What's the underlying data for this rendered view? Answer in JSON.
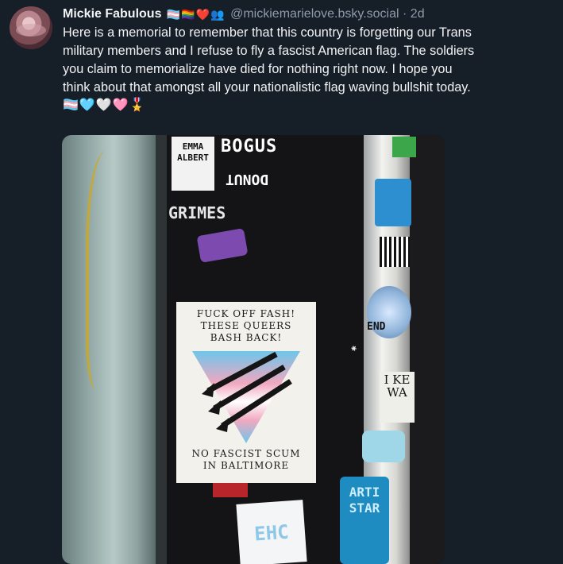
{
  "post": {
    "author_name": "Mickie Fabulous",
    "author_badges": "🏳️‍⚧️🏳️‍🌈❤️👥",
    "handle": "@mickiemarielove.bsky.social",
    "separator": "·",
    "timestamp": "2d",
    "text_lines": [
      "Here is a memorial to remember that this country is forgetting our Trans",
      "military members and I refuse to fly a fascist American flag. The soldiers",
      "you claim to memorialize have died for nothing right now. I hope you",
      "think about that amongst all your nationalistic flag waving bullshit today."
    ],
    "emoji_line": "🏳️‍⚧️🩵🤍🩷🎖️"
  },
  "photo": {
    "stickers": {
      "bogus": "BOGUS",
      "donut": "DONUT",
      "grimes": "GRIMES",
      "emma": "EMMA ALBERT",
      "end": "END",
      "ken": "I KE WA",
      "artistar": "ARTI STAR",
      "ehc": "EHC"
    },
    "poster": {
      "top_lines": [
        "FUCK OFF FASH!",
        "THESE QUEERS",
        "BASH BACK!"
      ],
      "bottom_lines": [
        "NO FASCIST SCUM",
        "IN BALTIMORE"
      ]
    }
  },
  "colors": {
    "background": "#161e27",
    "handle": "#8e9bab",
    "trans_blue": "#6ec6ea",
    "trans_pink": "#f0a8c0"
  }
}
